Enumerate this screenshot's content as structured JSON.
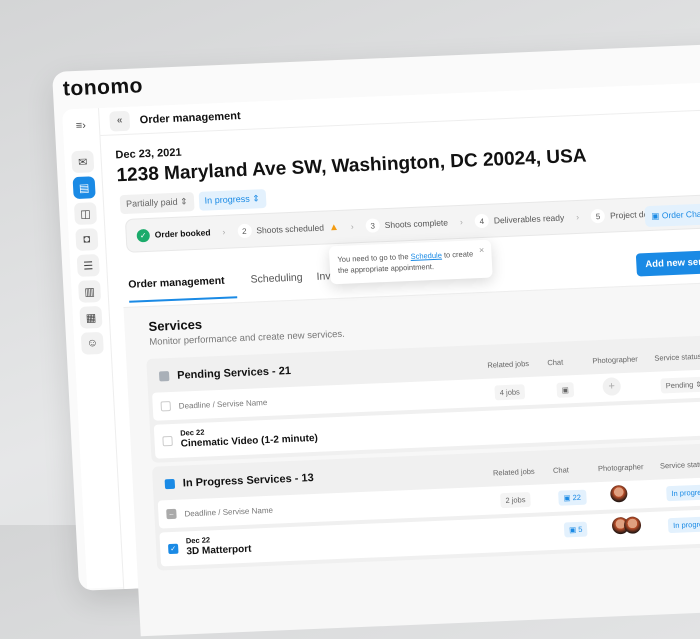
{
  "app": {
    "logo": "tonomo"
  },
  "sidebar": {
    "items": [
      "toggle",
      "inbox",
      "orders",
      "devices",
      "calendar",
      "services",
      "reports",
      "schedule",
      "user-settings"
    ]
  },
  "header": {
    "back": "«",
    "title": "Order management"
  },
  "order": {
    "date": "Dec 23, 2021",
    "address": "1238 Maryland Ave SW, Washington, DC 20024, USA",
    "payment": "Partially paid",
    "status": "In progress"
  },
  "steps": [
    {
      "num": "",
      "label": "Order booked"
    },
    {
      "num": "2",
      "label": "Shoots scheduled"
    },
    {
      "num": "3",
      "label": "Shoots complete"
    },
    {
      "num": "4",
      "label": "Deliverables ready"
    },
    {
      "num": "5",
      "label": "Project delivered"
    }
  ],
  "order_chat": "Order Chat",
  "tooltip": {
    "pre": "You need to go to the ",
    "link": "Schedule",
    "post": " to create the appropriate appointment."
  },
  "tabs": [
    "Order management",
    "Scheduling",
    "Invoi"
  ],
  "add_service": "Add new service",
  "services": {
    "title": "Services",
    "subtitle": "Monitor performance and create new services.",
    "columns": {
      "name": "Deadline / Servise Name",
      "jobs": "Related jobs",
      "chat": "Chat",
      "photographer": "Photographer",
      "status": "Service status"
    },
    "pending": {
      "title": "Pending Services - 21",
      "jobs": "4 jobs",
      "status": "Pending",
      "rows": [
        {
          "date": "Dec 22",
          "name": "Cinematic Video (1-2 minute)"
        }
      ]
    },
    "in_progress": {
      "title": "In Progress Services - 13",
      "jobs": "2 jobs",
      "chat": "22",
      "status": "In progress",
      "rows": [
        {
          "date": "Dec 22",
          "name": "3D Matterport",
          "chat": "5",
          "status": "In progress"
        }
      ]
    }
  }
}
